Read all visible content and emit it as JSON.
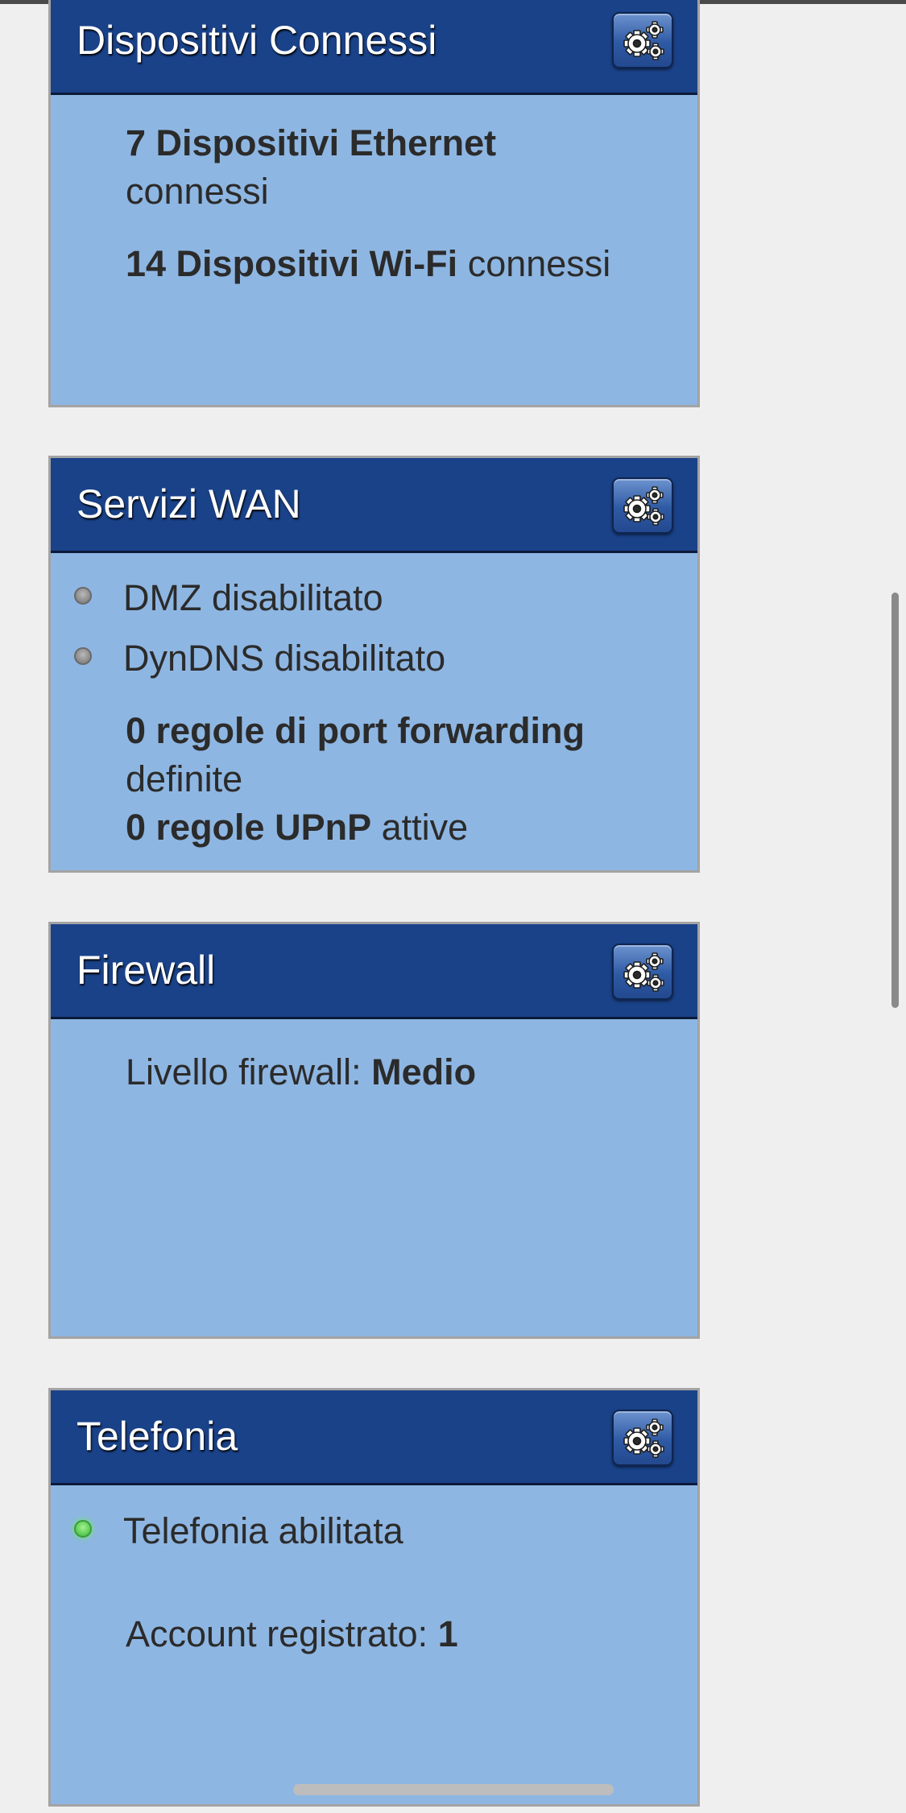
{
  "icons": {
    "settings": "gears-icon",
    "status_off": "grey-status-dot",
    "status_on": "green-status-dot"
  },
  "colors": {
    "header_bg": "#1a4289",
    "panel_bg": "#8eb6e2",
    "page_bg": "#efefef",
    "status_off": "#8e8e8e",
    "status_on": "#5fd05a"
  },
  "connected_devices": {
    "title": "Dispositivi Connessi",
    "ethernet_count_label": "7 Dispositivi Ethernet",
    "ethernet_suffix": "connessi",
    "wifi_count_label": "14 Dispositivi Wi-Fi",
    "wifi_suffix": "connessi"
  },
  "wan_services": {
    "title": "Servizi WAN",
    "dmz_status": "DMZ disabilitato",
    "dyndns_status": "DynDNS disabilitato",
    "port_forwarding_label": "0 regole di port forwarding",
    "port_forwarding_suffix": "definite",
    "upnp_label": "0 regole UPnP",
    "upnp_suffix": "attive"
  },
  "firewall": {
    "title": "Firewall",
    "level_label": "Livello firewall:",
    "level_value": "Medio"
  },
  "telephony": {
    "title": "Telefonia",
    "status": "Telefonia abilitata",
    "account_label": "Account registrato:",
    "account_value": "1"
  }
}
